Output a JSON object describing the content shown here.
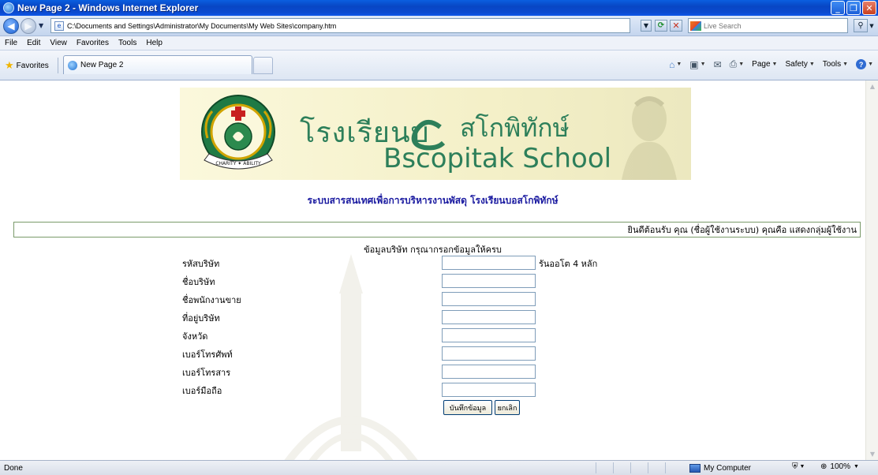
{
  "window": {
    "title": "New Page 2 - Windows Internet Explorer",
    "controls": {
      "minimize": "_",
      "maximize": "❐",
      "close": "✕"
    }
  },
  "address_bar": {
    "url": "C:\\Documents and Settings\\Administrator\\My Documents\\My Web Sites\\company.htm",
    "search_placeholder": "Live Search"
  },
  "menu": [
    "File",
    "Edit",
    "View",
    "Favorites",
    "Tools",
    "Help"
  ],
  "favorites_bar": {
    "favorites_label": "Favorites",
    "tab_label": "New Page 2",
    "tools": {
      "page": "Page",
      "safety": "Safety",
      "tools": "Tools"
    }
  },
  "page": {
    "banner": {
      "thai_name_1": "โรงเรียนบ",
      "thai_name_2": "สโกพิทักษ์",
      "english_name": "Bscopitak School",
      "seal_top_text": "โรงเรียนบอสโกพิทักษ์",
      "seal_ribbon": "CHARITY ✦ ABILITY"
    },
    "title": "ระบบสารสนเทศเพื่อการบริหารงานพัสดุ โรงเรียนบอสโกพิทักษ์",
    "welcome": "ยินดีต้อนรับ คุณ (ชื่อผู้ใช้งานระบบ) คุณคือ แสดงกลุ่มผู้ใช้งาน",
    "form_heading": "ข้อมูลบริษัท กรุณากรอกข้อมูลให้ครบ",
    "fields": [
      {
        "label": "รหัสบริษัท",
        "value": "",
        "hint": "รันออโต 4 หลัก"
      },
      {
        "label": "ชื่อบริษัท",
        "value": ""
      },
      {
        "label": "ชื่อพนักงานขาย",
        "value": ""
      },
      {
        "label": "ที่อยู่บริษัท",
        "value": ""
      },
      {
        "label": "จังหวัด",
        "value": ""
      },
      {
        "label": "เบอร์โทรศัพท์",
        "value": ""
      },
      {
        "label": "เบอร์โทรสาร",
        "value": ""
      },
      {
        "label": "เบอร์มือถือ",
        "value": ""
      }
    ],
    "buttons": {
      "save": "บันทึกข้อมูล",
      "cancel": "ยกเลิก"
    }
  },
  "status_bar": {
    "text": "Done",
    "zone": "My Computer",
    "zoom": "100%"
  },
  "colors": {
    "title_blue": "#1a1aa0",
    "banner_green": "#2d7f5a",
    "titlebar": "#0a4ad0"
  }
}
